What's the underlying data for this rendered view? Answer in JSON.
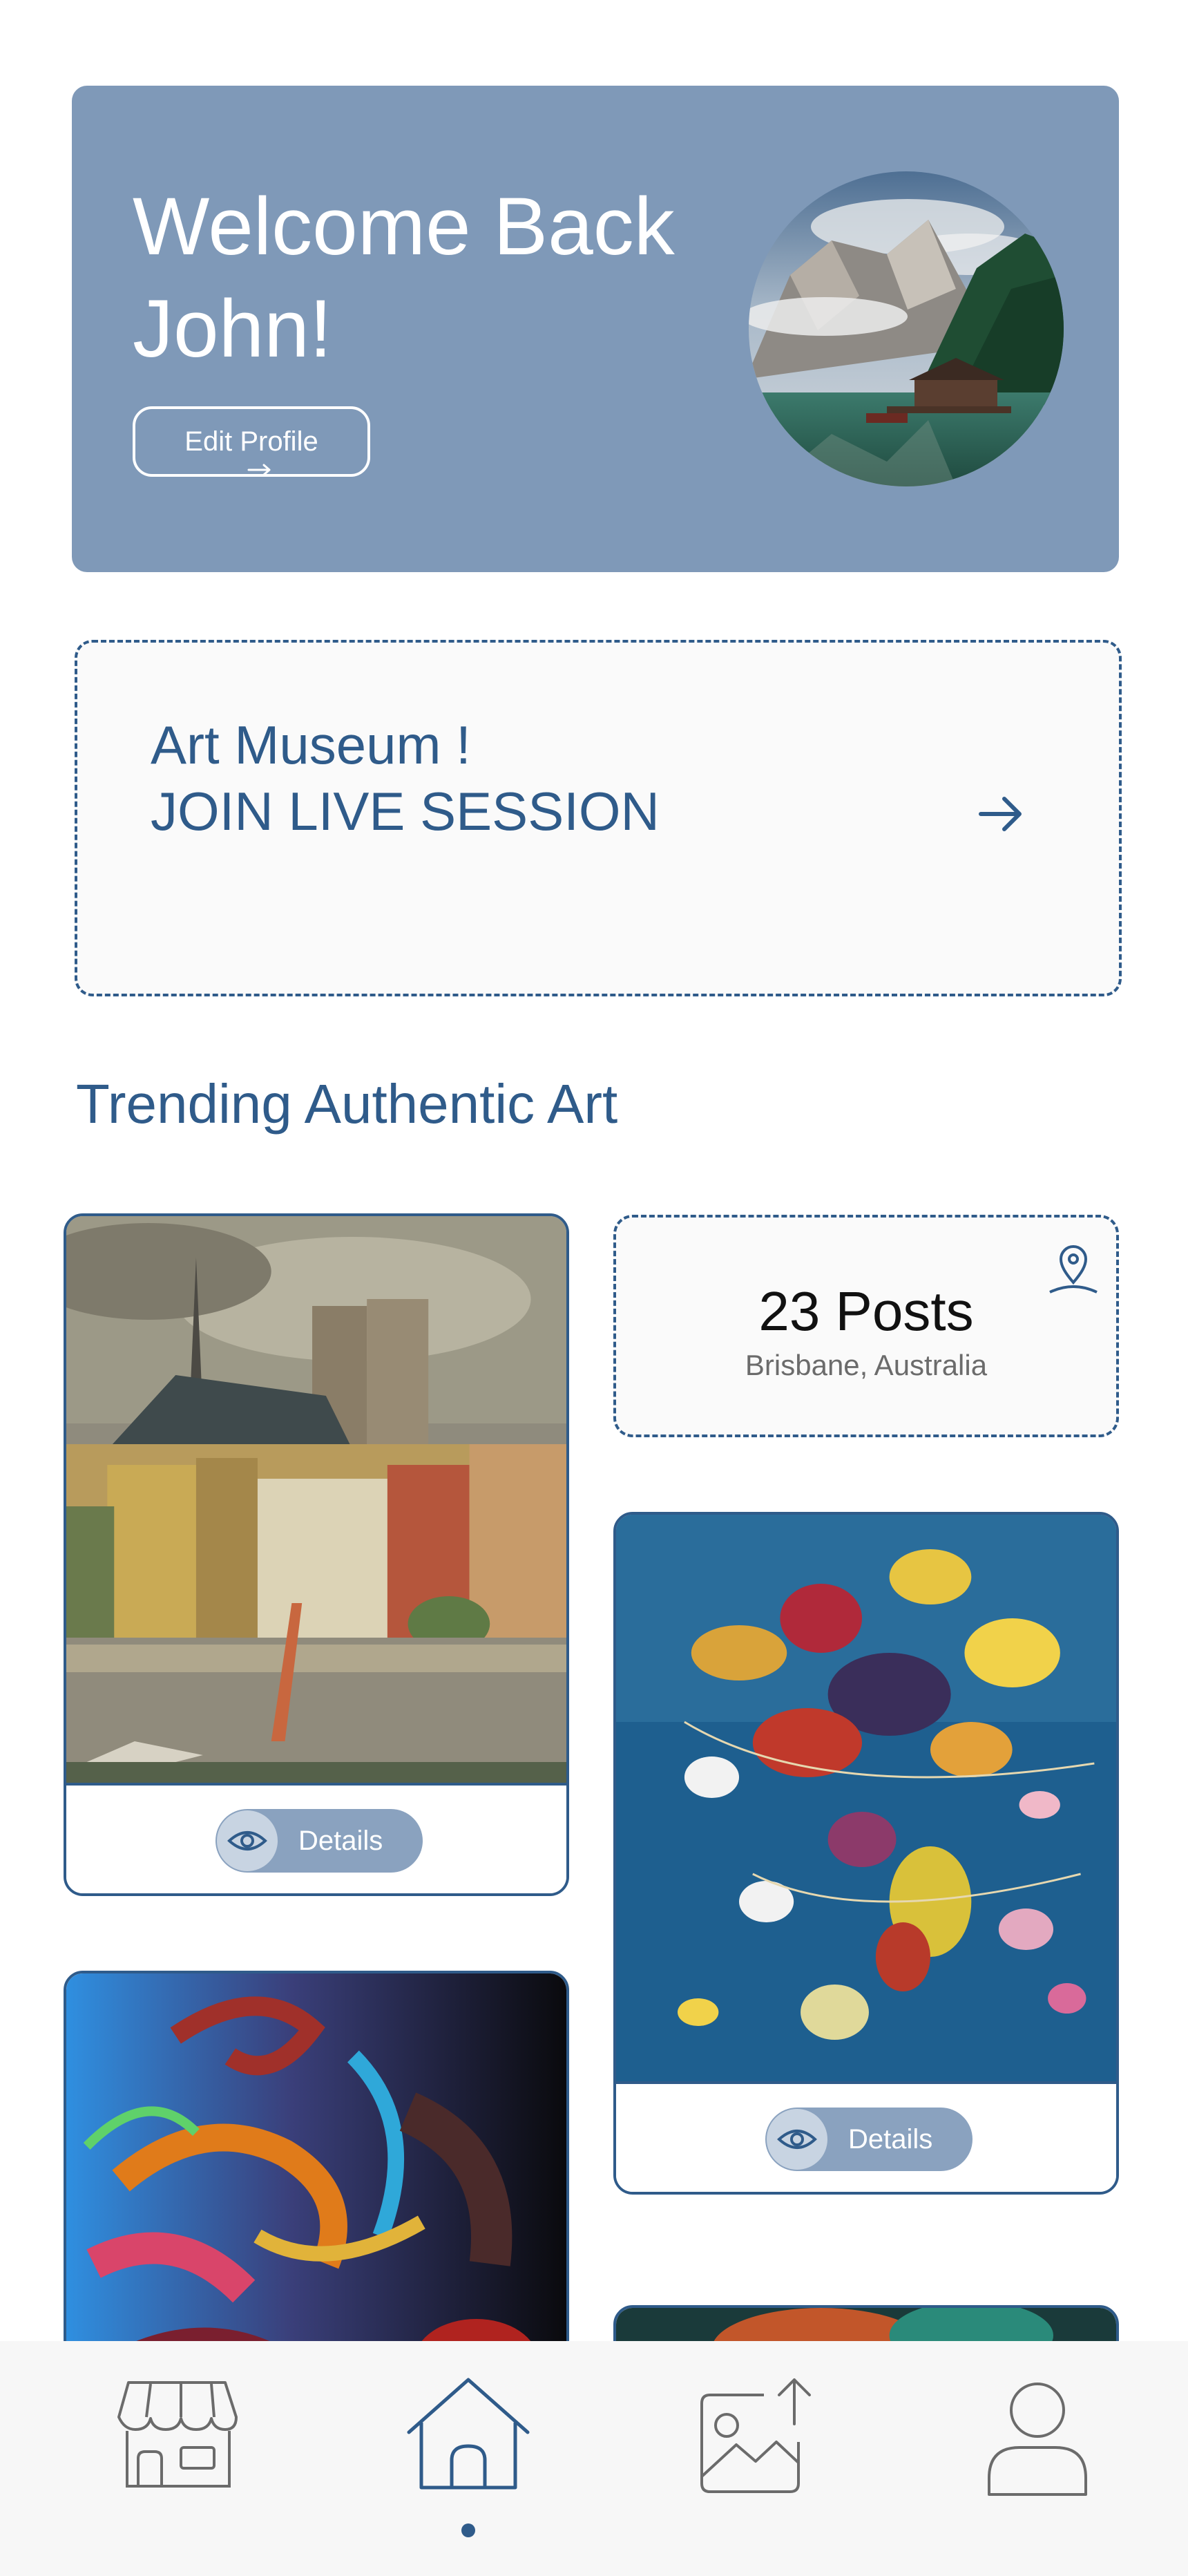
{
  "welcome": {
    "title": "Welcome Back\nJohn!",
    "edit_profile_label": "Edit Profile"
  },
  "live_session": {
    "text": "Art Museum !\nJOIN LIVE SESSION"
  },
  "trending": {
    "title": "Trending Authentic Art",
    "details_label": "Details",
    "posts": {
      "count": "23 Posts",
      "location": "Brisbane, Australia"
    }
  },
  "icons": {
    "arrow": "arrow-right-icon",
    "eye": "eye-icon",
    "pin": "location-pin-icon",
    "nav": [
      "shop-icon",
      "home-icon",
      "image-upload-icon",
      "user-icon"
    ]
  },
  "bottom_nav": {
    "active": "home"
  },
  "colors": {
    "accent": "#2f5b8a",
    "welcome_card": "#7f99b8",
    "details_button": "#8aa2bf"
  }
}
